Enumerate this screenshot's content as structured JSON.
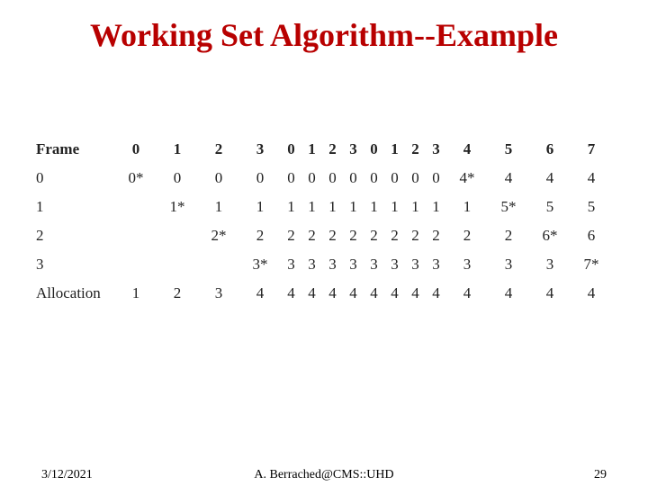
{
  "title": "Working Set Algorithm--Example",
  "footer": {
    "date": "3/12/2021",
    "author": "A. Berrached@CMS::UHD",
    "page": "29"
  },
  "table": {
    "header_label": "Frame",
    "columns": [
      "0",
      "1",
      "2",
      "3",
      "0",
      "1",
      "2",
      "3",
      "0",
      "1",
      "2",
      "3",
      "4",
      "5",
      "6",
      "7"
    ],
    "rows": [
      {
        "label": "0",
        "cells": [
          "0*",
          "0",
          "0",
          "0",
          "0",
          "0",
          "0",
          "0",
          "0",
          "0",
          "0",
          "0",
          "4*",
          "4",
          "4",
          "4"
        ]
      },
      {
        "label": "1",
        "cells": [
          "",
          "1*",
          "1",
          "1",
          "1",
          "1",
          "1",
          "1",
          "1",
          "1",
          "1",
          "1",
          "1",
          "5*",
          "5",
          "5"
        ]
      },
      {
        "label": "2",
        "cells": [
          "",
          "",
          "2*",
          "2",
          "2",
          "2",
          "2",
          "2",
          "2",
          "2",
          "2",
          "2",
          "2",
          "2",
          "6*",
          "6"
        ]
      },
      {
        "label": "3",
        "cells": [
          "",
          "",
          "",
          "3*",
          "3",
          "3",
          "3",
          "3",
          "3",
          "3",
          "3",
          "3",
          "3",
          "3",
          "3",
          "7*"
        ]
      },
      {
        "label": "Allocation",
        "cells": [
          "1",
          "2",
          "3",
          "4",
          "4",
          "4",
          "4",
          "4",
          "4",
          "4",
          "4",
          "4",
          "4",
          "4",
          "4",
          "4"
        ]
      }
    ]
  },
  "chart_data": {
    "type": "table",
    "title": "Working Set Algorithm--Example",
    "columns": [
      "Frame",
      "0",
      "1",
      "2",
      "3",
      "0",
      "1",
      "2",
      "3",
      "0",
      "1",
      "2",
      "3",
      "4",
      "5",
      "6",
      "7"
    ],
    "rows": [
      [
        "0",
        "0*",
        "0",
        "0",
        "0",
        "0",
        "0",
        "0",
        "0",
        "0",
        "0",
        "0",
        "0",
        "4*",
        "4",
        "4",
        "4"
      ],
      [
        "1",
        "",
        "1*",
        "1",
        "1",
        "1",
        "1",
        "1",
        "1",
        "1",
        "1",
        "1",
        "1",
        "1",
        "5*",
        "5",
        "5"
      ],
      [
        "2",
        "",
        "",
        "2*",
        "2",
        "2",
        "2",
        "2",
        "2",
        "2",
        "2",
        "2",
        "2",
        "2",
        "2",
        "6*",
        "6"
      ],
      [
        "3",
        "",
        "",
        "",
        "3*",
        "3",
        "3",
        "3",
        "3",
        "3",
        "3",
        "3",
        "3",
        "3",
        "3",
        "3",
        "7*"
      ],
      [
        "Allocation",
        "1",
        "2",
        "3",
        "4",
        "4",
        "4",
        "4",
        "4",
        "4",
        "4",
        "4",
        "4",
        "4",
        "4",
        "4",
        "4"
      ]
    ]
  }
}
